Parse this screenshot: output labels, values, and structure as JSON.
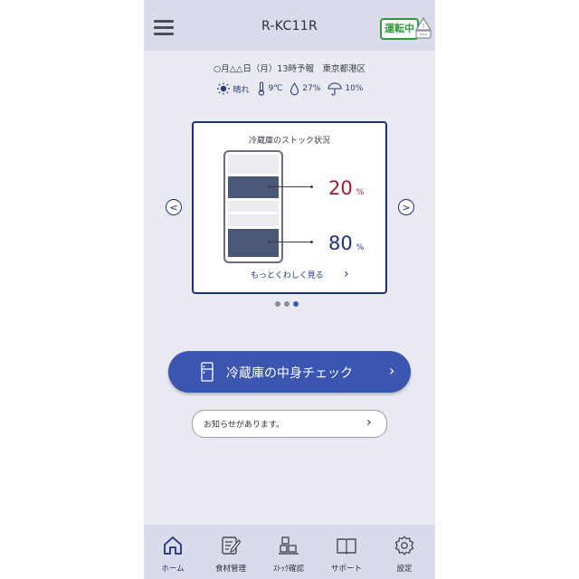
{
  "header": {
    "title": "R-KC11R",
    "status_badge": "運転中"
  },
  "forecast": {
    "text": "○月△△日（月）13時予報　東京都港区"
  },
  "weather": {
    "condition": "晴れ",
    "temperature": "9℃",
    "humidity": "27%",
    "rain": "10%"
  },
  "stock_card": {
    "title": "冷蔵庫のストック状況",
    "upper": {
      "value": "20",
      "unit": "%"
    },
    "lower": {
      "value": "80",
      "unit": "%"
    },
    "more_label": "もっとくわしく見る",
    "colors": {
      "upper_value": "#a11d2b",
      "lower_value": "#1f2f80",
      "fill": "#4b5779",
      "empty": "#eaecef"
    }
  },
  "pager": {
    "count": 3,
    "active": 3
  },
  "main_button": {
    "label": "冷蔵庫の中身チェック"
  },
  "notice": {
    "label": "お知らせがあります。"
  },
  "tabs": [
    {
      "label": "ホーム",
      "icon": "home-icon"
    },
    {
      "label": "食材管理",
      "icon": "food-management-icon"
    },
    {
      "label": "ｽﾄｯｸ確認",
      "icon": "stock-check-icon"
    },
    {
      "label": "サポート",
      "icon": "support-book-icon"
    },
    {
      "label": "設定",
      "icon": "settings-gear-icon"
    }
  ],
  "colors": {
    "accent": "#3a56b0",
    "header_bg": "#d9dbea",
    "page_bg": "#e9eaf2",
    "badge": "#2f9a3c"
  }
}
